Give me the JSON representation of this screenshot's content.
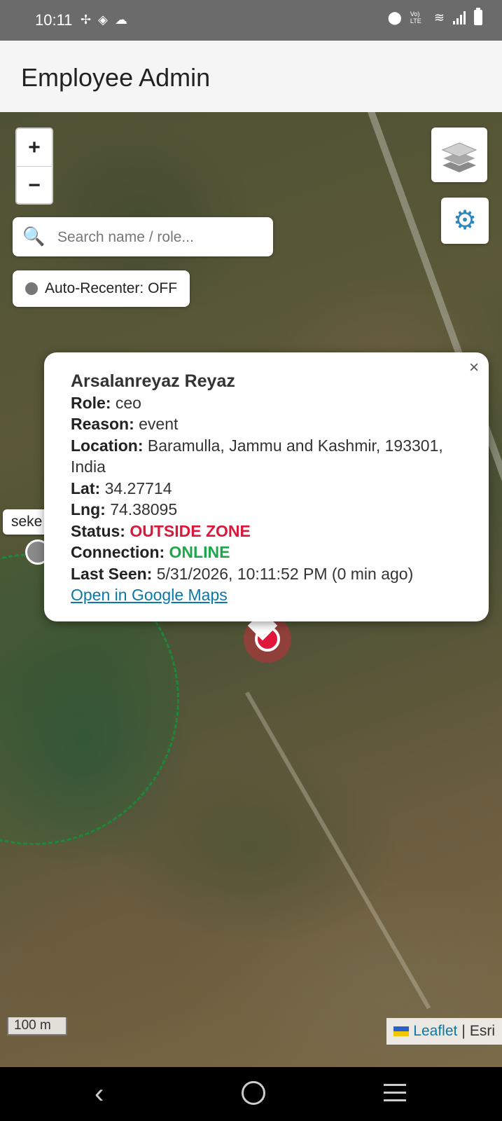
{
  "status_bar": {
    "time": "10:11",
    "left_icons": [
      "fan-icon",
      "location-target-icon",
      "cloud-icon"
    ],
    "right_icons": [
      "location-pin-icon",
      "volte-icon",
      "wifi-icon",
      "signal-icon",
      "battery-icon"
    ],
    "volte_text": "Vo) LTE"
  },
  "app_bar": {
    "title": "Employee Admin"
  },
  "map": {
    "zoom_in": "+",
    "zoom_out": "−",
    "search": {
      "placeholder": "Search name / role..."
    },
    "auto_recenter_label": "Auto-Recenter: OFF",
    "peer_label": "seke",
    "scale": "100 m",
    "attribution": {
      "leaflet": "Leaflet",
      "separator": "|",
      "esri": "Esri"
    }
  },
  "popup": {
    "close": "×",
    "name": "Arsalanreyaz Reyaz",
    "role_label": "Role:",
    "role": "ceo",
    "reason_label": "Reason:",
    "reason": "event",
    "location_label": "Location:",
    "location": "Baramulla, Jammu and Kashmir, 193301, India",
    "lat_label": "Lat:",
    "lat": "34.27714",
    "lng_label": "Lng:",
    "lng": "74.38095",
    "status_label": "Status:",
    "status": "OUTSIDE ZONE",
    "connection_label": "Connection:",
    "connection": "ONLINE",
    "last_seen_label": "Last Seen:",
    "last_seen": "5/31/2026, 10:11:52 PM (0 min ago)",
    "gmaps_link": "Open in Google Maps"
  },
  "colors": {
    "status_outside": "#d9183b",
    "connection_online": "#1ea74b",
    "link": "#0a78a8",
    "zone": "#1a8a3a",
    "marker": "#e0173a"
  }
}
